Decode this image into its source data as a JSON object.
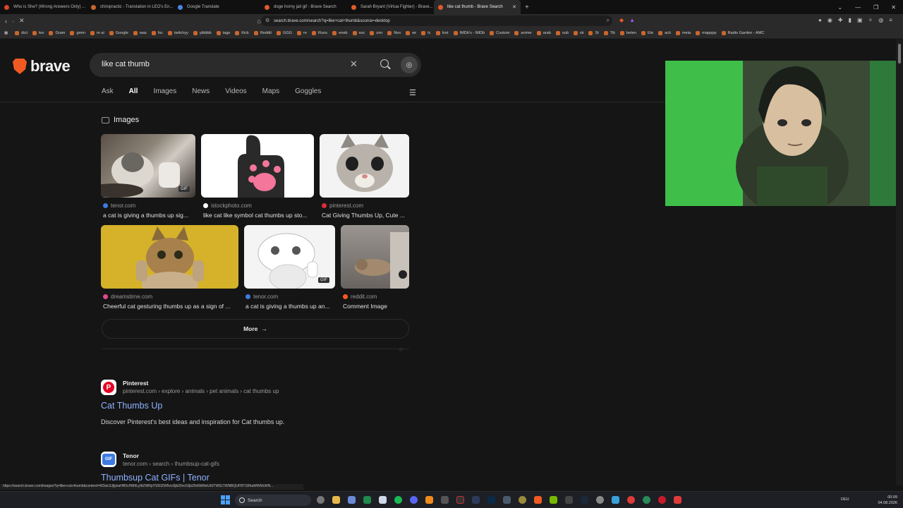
{
  "tabs": [
    {
      "label": "Who is She? (Wrong Answers Only) ...",
      "fav_color": "#d8452b"
    },
    {
      "label": "chiropractic - Translation in LEO's En...",
      "fav_color": "#c9662c"
    },
    {
      "label": "Google Translate",
      "fav_color": "#4a86e8"
    },
    {
      "label": "doge horny jail gif - Brave Search",
      "fav_color": "#e05a2a"
    },
    {
      "label": "Sarah Bryant (Virtua Fighter) - Brave...",
      "fav_color": "#e05a2a"
    },
    {
      "label": "like cat thumb - Brave Search",
      "fav_color": "#e05a2a"
    }
  ],
  "address_bar": {
    "url": "search.brave.com/search?q=like+cat+thumb&source=desktop"
  },
  "bookmarks": [
    "dict",
    "leo",
    "Gram",
    "gmm",
    "re ai",
    "Google",
    "was",
    "fsc",
    "twitchyy",
    "ytbbbb",
    "tags",
    "Kick",
    "Reddit",
    "GGG",
    "re",
    "Runs",
    "eneb",
    "soc",
    "zon",
    "Nex",
    "wr",
    "tc",
    "Inst",
    "IMDb's - IMDb",
    "Custom",
    "anime",
    "arab",
    "sub",
    "sk",
    "St",
    "Tik",
    "beten",
    "Ele",
    "acti",
    "meta",
    "mapppp",
    "Radio Garden - AMC"
  ],
  "logo": {
    "text": "brave"
  },
  "search": {
    "query": "like cat thumb"
  },
  "nav_tabs": [
    "Ask",
    "All",
    "Images",
    "News",
    "Videos",
    "Maps",
    "Goggles"
  ],
  "images_section": {
    "heading": "Images",
    "row1": [
      {
        "source": "tenor.com",
        "caption": "a cat is giving a thumbs up sig...",
        "gif": "GIF",
        "icon_color": "#3d7be0"
      },
      {
        "source": "istockphoto.com",
        "caption": "like cat like symbol cat thumbs up sto...",
        "gif": "",
        "icon_color": "#ffffff"
      },
      {
        "source": "pinterest.com",
        "caption": "Cat Giving Thumbs Up, Cute ...",
        "gif": "",
        "icon_color": "#e02b3a"
      }
    ],
    "row2": [
      {
        "source": "dreamstime.com",
        "caption": "Cheerful cat gesturing thumbs up as a sign of ...",
        "gif": "",
        "icon_color": "#e04a8a"
      },
      {
        "source": "tenor.com",
        "caption": "a cat is giving a thumbs up an...",
        "gif": "GIF",
        "icon_color": "#3d7be0"
      },
      {
        "source": "reddit.com",
        "caption": "Comment Image",
        "gif": "",
        "icon_color": "#ff5a1f"
      }
    ],
    "more_label": "More"
  },
  "results": [
    {
      "site": "Pinterest",
      "crumb": "pinterest.com › explore › animals › pet animals › cat thumbs up",
      "title": "Cat Thumbs Up",
      "description": "Discover Pinterest's best ideas and inspiration for Cat thumbs up.",
      "icon_color": "#e60023",
      "icon_text": "P"
    },
    {
      "site": "Tenor",
      "crumb": "tenor.com › search › thumbsup-cat-gifs",
      "title": "Thumbsup Cat GIFs | Tenor",
      "description": "",
      "icon_color": "#3d7be0",
      "icon_text": "GIF"
    }
  ],
  "status_url": "https://search.brave.com/images?q=like+cat+thumb&context=W3sic3JjIjoiaHR0cHM6Ly9tZWRpYS50ZW5vci5jb20vc0Jjb20vRkRteUtSTWSLTWNBQUFBTS9haWWhlLWN...",
  "taskbar": {
    "search_label": "Search",
    "lang": "DEU",
    "time": "00:09",
    "date": "04.08.2026"
  },
  "colors": {
    "accent": "#f05a22",
    "link": "#8fb2ff",
    "background": "#151515"
  }
}
